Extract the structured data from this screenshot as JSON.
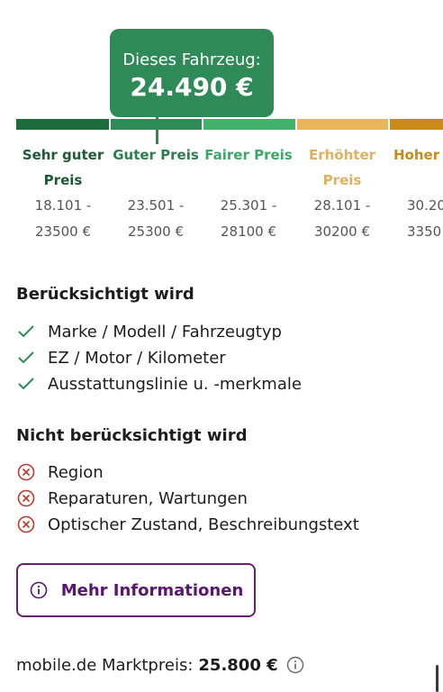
{
  "tooltip": {
    "label": "Dieses Fahrzeug:",
    "price": "24.490 €"
  },
  "price_scale": [
    {
      "label_line1": "Sehr guter",
      "label_line2": "Preis",
      "range_line1": "18.101 -",
      "range_line2": "23500 €",
      "color": "#1e6b3d"
    },
    {
      "label_line1": "Guter Preis",
      "label_line2": "",
      "range_line1": "23.501 -",
      "range_line2": "25300 €",
      "color": "#2e8b57"
    },
    {
      "label_line1": "Fairer Preis",
      "label_line2": "",
      "range_line1": "25.301 -",
      "range_line2": "28100 €",
      "color": "#44b06a"
    },
    {
      "label_line1": "Erhöhter",
      "label_line2": "Preis",
      "range_line1": "28.101 -",
      "range_line2": "30200 €",
      "color": "#e8b55c"
    },
    {
      "label_line1": "Hoher P",
      "label_line2": "",
      "range_line1": "30.20",
      "range_line2": "3350",
      "color": "#c98a1b"
    }
  ],
  "considered": {
    "title": "Berücksichtigt wird",
    "items": [
      "Marke / Modell / Fahrzeugtyp",
      "EZ / Motor / Kilometer",
      "Ausstattungslinie u. -merkmale"
    ],
    "icon": "checkmark-icon"
  },
  "not_considered": {
    "title": "Nicht berücksichtigt wird",
    "items": [
      "Region",
      "Reparaturen, Wartungen",
      "Optischer Zustand, Beschreibungstext"
    ],
    "icon": "x-circle-icon"
  },
  "more_button": {
    "label": "Mehr Informationen",
    "icon": "info-icon"
  },
  "market_price": {
    "label": "mobile.de Marktpreis:",
    "value": "25.800 €",
    "icon": "info-icon"
  },
  "colors": {
    "accent_purple": "#6a1e74",
    "check_green": "#2e8b57",
    "x_red": "#c0392b"
  }
}
